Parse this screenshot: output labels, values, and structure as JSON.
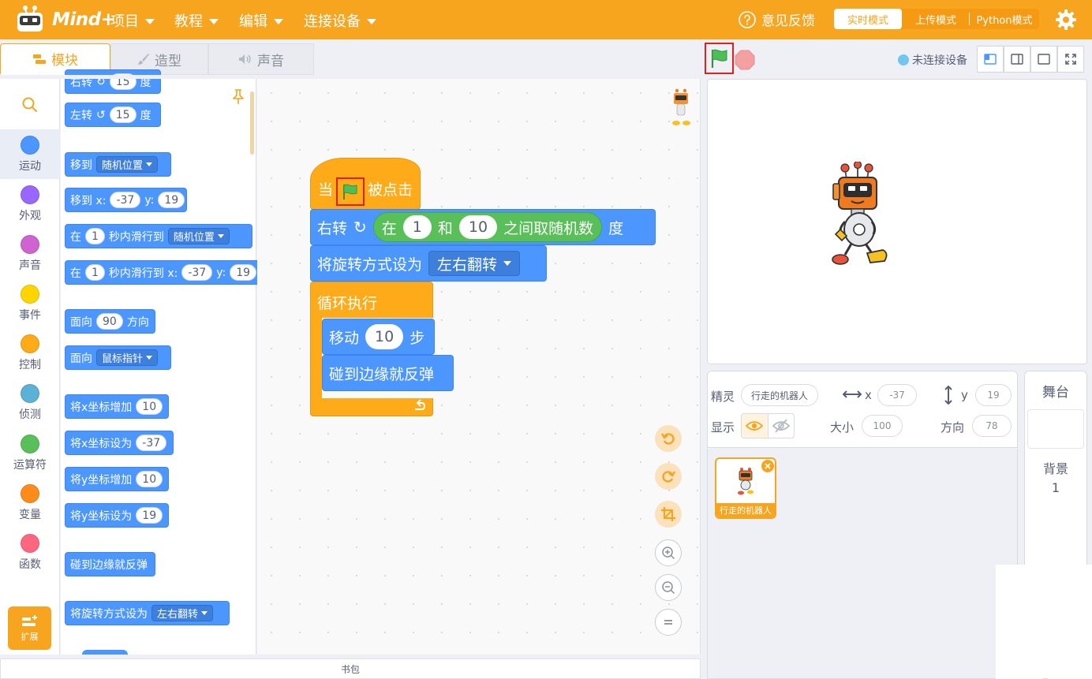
{
  "menubar": {
    "logo_text": "Mind+",
    "items": [
      "项目",
      "教程",
      "编辑",
      "连接设备"
    ],
    "feedback": "意见反馈",
    "modes": [
      "实时模式",
      "上传模式",
      "Python模式"
    ]
  },
  "tabs": [
    "模块",
    "造型",
    "声音"
  ],
  "categories": [
    "运动",
    "外观",
    "声音",
    "事件",
    "控制",
    "侦测",
    "运算符",
    "变量",
    "函数"
  ],
  "category_colors": [
    "#4c97ff",
    "#9966ff",
    "#cf63cf",
    "#ffd500",
    "#ffab19",
    "#5cb1d6",
    "#59c059",
    "#ff8c1a",
    "#ff6680"
  ],
  "extension_label": "扩展",
  "palette": {
    "top_partial": "右转",
    "top_partial_deg": "15",
    "top_partial_unit": "度",
    "turn_left": "左转",
    "turn_left_deg": "15",
    "turn_left_unit": "度",
    "goto_label": "移到",
    "goto_value": "随机位置",
    "gotoxy_label": "移到 x:",
    "gotoxy_x": "-37",
    "gotoxy_ylabel": "y:",
    "gotoxy_y": "19",
    "glide_in": "在",
    "glide_secs": "1",
    "glide_to": "秒内滑行到",
    "glide_value": "随机位置",
    "glide2_in": "在",
    "glide2_secs": "1",
    "glide2_to": "秒内滑行到 x:",
    "glide2_x": "-37",
    "glide2_ylabel": "y:",
    "glide2_y": "19",
    "point_label": "面向",
    "point_value": "90",
    "point_unit": "方向",
    "pointto_label": "面向",
    "pointto_value": "鼠标指针",
    "changex_label": "将x坐标增加",
    "changex_value": "10",
    "setx_label": "将x坐标设为",
    "setx_value": "-37",
    "changey_label": "将y坐标增加",
    "changey_value": "10",
    "sety_label": "将y坐标设为",
    "sety_value": "19",
    "bounce": "碰到边缘就反弹",
    "rotstyle_label": "将旋转方式设为",
    "rotstyle_value": "左右翻转"
  },
  "script": {
    "hat_when": "当",
    "hat_clicked": "被点击",
    "turn_right": "右转",
    "rand_in": "在",
    "rand_from": "1",
    "rand_and": "和",
    "rand_to": "10",
    "rand_between": "之间取随机数",
    "deg": "度",
    "rotstyle_label": "将旋转方式设为",
    "rotstyle_value": "左右翻转",
    "forever": "循环执行",
    "move_label": "移动",
    "move_value": "10",
    "move_unit": "步",
    "bounce": "碰到边缘就反弹"
  },
  "backpack": "书包",
  "stage_header": {
    "connection_status": "未连接设备"
  },
  "sprite_info": {
    "sprite_label": "精灵",
    "sprite_name": "行走的机器人",
    "x_label": "x",
    "x_value": "-37",
    "y_label": "y",
    "y_value": "19",
    "show_label": "显示",
    "size_label": "大小",
    "size_value": "100",
    "direction_label": "方向",
    "direction_value": "78"
  },
  "sprite_thumb_label": "行走的机器人",
  "stage_column": {
    "title": "舞台",
    "backdrop_label": "背景",
    "backdrop_count": "1"
  },
  "colors": {
    "accent": "#f7a41f",
    "motion": "#4c97ff",
    "control": "#ffab19",
    "operator": "#59c059",
    "highlight": "#e0201f"
  }
}
